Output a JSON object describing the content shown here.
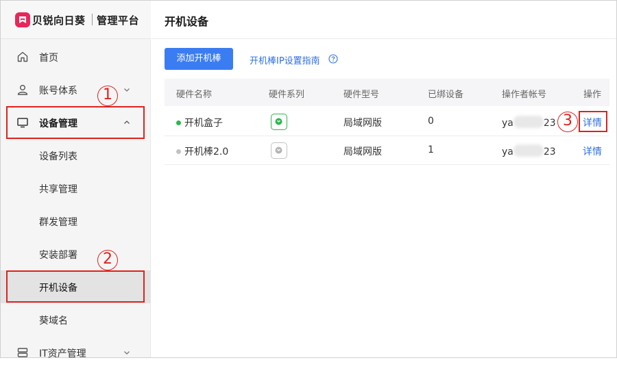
{
  "brand": {
    "name": "贝锐向日葵",
    "sub": "管理平台"
  },
  "sidebar": {
    "items": [
      {
        "label": "首页",
        "icon": "home-icon"
      },
      {
        "label": "账号体系",
        "icon": "user-icon"
      },
      {
        "label": "设备管理",
        "icon": "monitor-icon"
      },
      {
        "label": "设备列表"
      },
      {
        "label": "共享管理"
      },
      {
        "label": "群发管理"
      },
      {
        "label": "安装部署"
      },
      {
        "label": "开机设备"
      },
      {
        "label": "葵域名"
      },
      {
        "label": "IT资产管理",
        "icon": "server-icon"
      }
    ]
  },
  "annotations": {
    "one": "1",
    "two": "2",
    "three": "3"
  },
  "main": {
    "title": "开机设备",
    "add_button": "添加开机棒",
    "guide_link": "开机棒IP设置指南",
    "columns": [
      "硬件名称",
      "硬件系列",
      "硬件型号",
      "已绑设备",
      "操作者帐号",
      "操作"
    ],
    "rows": [
      {
        "name": "开机盒子",
        "status": "online",
        "status_color": "#2db84d",
        "series_icon": "green-power-box-icon",
        "model": "局域网版",
        "bound": "0",
        "account_prefix": "ya",
        "account_suffix": "23",
        "action": "详情"
      },
      {
        "name": "开机棒2.0",
        "status": "offline",
        "status_color": "#c2c2c2",
        "series_icon": "grey-power-stick-icon",
        "model": "局域网版",
        "bound": "1",
        "account_prefix": "ya",
        "account_suffix": "23",
        "action": "详情"
      }
    ]
  },
  "colors": {
    "accent": "#3a7cf2",
    "brand": "#e8265a",
    "annotation": "#e0201d",
    "link": "#2f6fe3"
  }
}
